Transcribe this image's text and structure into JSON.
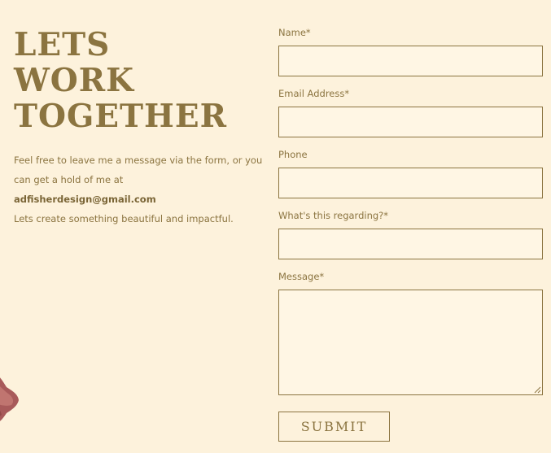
{
  "heading": {
    "lines": [
      "LETS",
      "WORK",
      "TOGETHER"
    ]
  },
  "intro": {
    "text": "Feel free to leave me a message via the form, or you can get a hold of me at ",
    "email": "adfisherdesign@gmail.com",
    "tagline": "Lets create something beautiful and impactful."
  },
  "form": {
    "name_label": "Name*",
    "email_label": "Email Address*",
    "phone_label": "Phone",
    "regarding_label": "What's this regarding?*",
    "message_label": "Message*",
    "submit_label": "SUBMIT"
  },
  "colors": {
    "background": "#fdf2dc",
    "accent": "#8b7440",
    "field_background": "#fff6e4",
    "flower": "#a85a5a"
  }
}
